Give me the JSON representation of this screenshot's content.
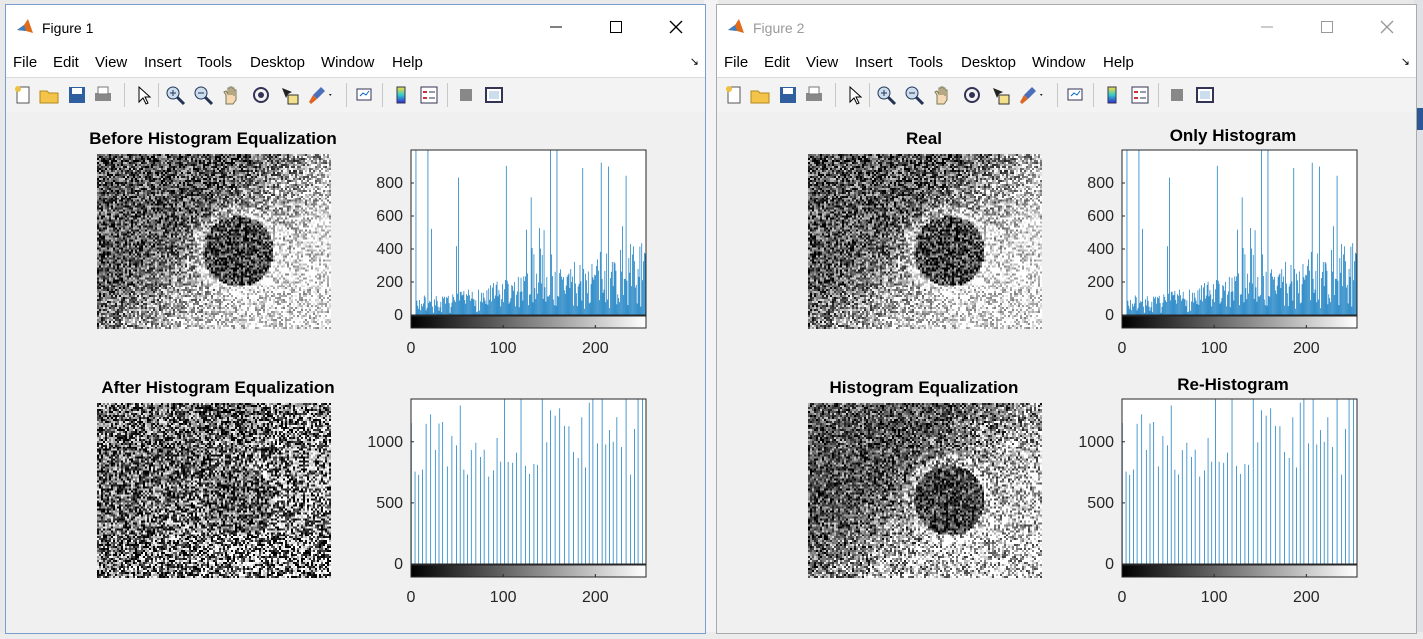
{
  "menus": [
    "File",
    "Edit",
    "View",
    "Insert",
    "Tools",
    "Desktop",
    "Window",
    "Help"
  ],
  "colors": {
    "bar": "#0072BD",
    "axes": "#262626",
    "plot_bg": "#ffffff",
    "figure_bg": "#f0f0f0",
    "active_border": "#7a9ccf"
  },
  "toolbar_icons": [
    "new-figure-icon",
    "open-file-icon",
    "save-figure-icon",
    "print-figure-icon",
    "edit-plot-arrow-icon",
    "zoom-in-icon",
    "zoom-out-icon",
    "pan-hand-icon",
    "rotate-3d-icon",
    "data-cursor-icon",
    "brush-icon",
    "brush-dropdown-icon",
    "link-plot-icon",
    "insert-colorbar-icon",
    "insert-legend-icon",
    "hide-plot-tools-icon",
    "show-plot-tools-icon"
  ],
  "figures": [
    {
      "title": "Figure 1",
      "active": true,
      "subplots": [
        {
          "title": "Before Histogram Equalization"
        },
        {
          "title": ""
        },
        {
          "title": "After Histogram Equalization"
        },
        {
          "title": ""
        }
      ]
    },
    {
      "title": "Figure 2",
      "active": false,
      "subplots": [
        {
          "title": "Real"
        },
        {
          "title": "Only Histogram"
        },
        {
          "title": "Histogram Equalization"
        },
        {
          "title": "Re-Histogram"
        }
      ]
    }
  ],
  "chart_data": [
    {
      "type": "bar",
      "figure": "Figure 1",
      "title": "",
      "xlim": [
        0,
        255
      ],
      "ylim": [
        0,
        1000
      ],
      "xticks": [
        "0",
        "100",
        "200"
      ],
      "yticks": [
        "0",
        "200",
        "400",
        "600",
        "800"
      ],
      "grid": false,
      "colorbar": "grayscale under x axis",
      "profile": "original"
    },
    {
      "type": "bar",
      "figure": "Figure 1",
      "title": "",
      "xlim": [
        0,
        255
      ],
      "ylim": [
        0,
        1350
      ],
      "xticks": [
        "0",
        "100",
        "200"
      ],
      "yticks": [
        "0",
        "500",
        "1000"
      ],
      "grid": false,
      "colorbar": "grayscale under x axis",
      "profile": "equalized"
    },
    {
      "type": "bar",
      "figure": "Figure 2",
      "title": "Only Histogram",
      "xlim": [
        0,
        255
      ],
      "ylim": [
        0,
        1000
      ],
      "xticks": [
        "0",
        "100",
        "200"
      ],
      "yticks": [
        "0",
        "200",
        "400",
        "600",
        "800"
      ],
      "grid": false,
      "colorbar": "grayscale under x axis",
      "profile": "original"
    },
    {
      "type": "bar",
      "figure": "Figure 2",
      "title": "Re-Histogram",
      "xlim": [
        0,
        255
      ],
      "ylim": [
        0,
        1350
      ],
      "xticks": [
        "0",
        "100",
        "200"
      ],
      "yticks": [
        "0",
        "500",
        "1000"
      ],
      "grid": false,
      "colorbar": "grayscale under x axis",
      "profile": "equalized"
    }
  ]
}
